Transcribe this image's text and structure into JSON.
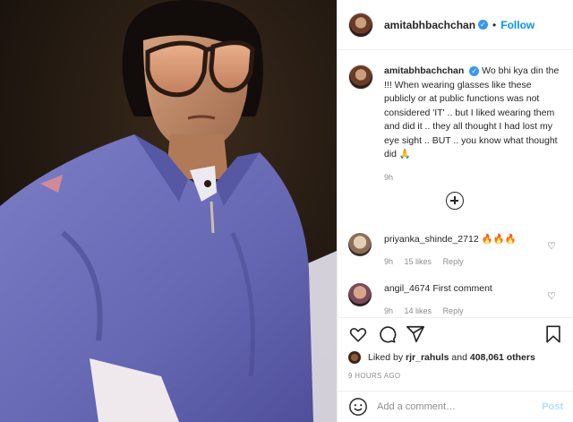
{
  "header": {
    "username": "amitabhbachchan",
    "separator": "•",
    "follow_label": "Follow"
  },
  "caption": {
    "username": "amitabhbachchan",
    "text": "Wo bhi kya din the !!! When wearing glasses like these publicly or at public functions was not considered 'IT' .. but I liked wearing them and did it .. they all thought I had lost my eye sight .. BUT .. you know what thought did 🙏",
    "time": "9h"
  },
  "comments": [
    {
      "username": "priyanka_shinde_2712",
      "text": "🔥🔥🔥",
      "time": "9h",
      "likes": "15 likes",
      "reply": "Reply",
      "avatar_color": "#c9b49a"
    },
    {
      "username": "angil_4674",
      "text": "First comment",
      "time": "9h",
      "likes": "14 likes",
      "reply": "Reply",
      "avatar_color": "#8a5a6a"
    }
  ],
  "likes": {
    "prefix": "Liked by",
    "user": "rjr_rahuls",
    "middle": "and",
    "count": "408,061 others"
  },
  "posted_ago": "9 HOURS AGO",
  "add_comment": {
    "placeholder": "Add a comment…",
    "post_label": "Post"
  },
  "colors": {
    "accent": "#0095f6",
    "verified": "#3897f0",
    "jacket": "#6e6fb8"
  },
  "icons": [
    "heart-icon",
    "comment-icon",
    "share-icon",
    "bookmark-icon",
    "emoji-icon",
    "add-icon",
    "verified-icon"
  ]
}
